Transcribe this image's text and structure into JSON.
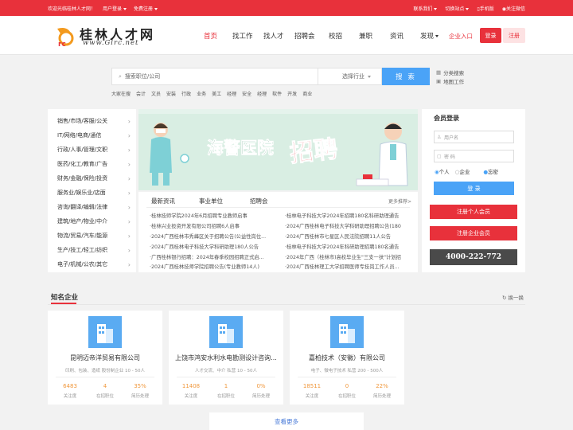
{
  "topbar": {
    "welcome": "欢迎光临桂林人才网！",
    "personal_login": "用户登录",
    "free_register": "免费注册",
    "contact_us": "联系我们",
    "switch_site": "切换站点",
    "mobile": "手机版",
    "wechat": "关注微信"
  },
  "header": {
    "logo_name": "桂林人才网",
    "logo_url": "www.Glrc.net",
    "nav": [
      "首页",
      "找工作",
      "找人才",
      "招聘会",
      "校招",
      "兼职",
      "资讯",
      "发现"
    ],
    "enterprise_entry": "企业入口",
    "login": "登录",
    "register": "注册"
  },
  "search": {
    "placeholder": "搜索职位/公司",
    "industry": "选择行业",
    "button": "搜 索",
    "category_search": "分类搜索",
    "map_search": "地图工作",
    "hotwords": [
      "大家在搜",
      "会计",
      "文员",
      "安装",
      "行政",
      "业务",
      "美工",
      "经理",
      "安全",
      "经理",
      "软件",
      "开发",
      "商业"
    ]
  },
  "categories": [
    "销售/市场/客服/公关",
    "IT/网络/电商/通信",
    "行政/人事/管理/文职",
    "医药/化工/教育/广告",
    "财务/金融/保险/投资",
    "服务业/娱乐业/店面",
    "咨询/翻译/编辑/法律",
    "建筑/地产/物业/中介",
    "物流/贸易/汽车/能源",
    "生产/技工/轻工/纺织",
    "电子/机械/公农/其它"
  ],
  "banner": {
    "text_main": "海警医院",
    "text_accent": "招聘"
  },
  "news": {
    "tabs": [
      "最新资讯",
      "事业单位",
      "招聘会"
    ],
    "more": "更多推荐>",
    "left": [
      "桂林技师学院2024年6月招聘专业教师启事",
      "桂林兴业投资开发有限公司招聘6人启事",
      "2024广西桂林市秀峰区关于招聘公告(公益性岗位...",
      "2024广西桂林电子科技大学科研助理180人公告",
      "广西桂林银行招聘：2024年春季校园招聘正式启...",
      "2024广西桂林技师学院招聘公告(专业教师14人)"
    ],
    "right": [
      "桂林电子科技大学2024年招聘180名科研助理通告",
      "2024广西桂林电子科技大学科研助理招聘公告(180",
      "2024广西桂林市七星区人民法院招聘11人公告",
      "桂林电子科技大学2024年科研助理招聘180名通告",
      "2024年广西（桂林市)高校毕业生\"三支一扶\"计划招",
      "2024广西桂林理工大学招聘医师专技岗工作人员..."
    ]
  },
  "member": {
    "title": "会员登录",
    "username": "用户名",
    "password": "密 码",
    "personal": "个人",
    "enterprise": "企业",
    "forgot": "忘密",
    "login": "登 录",
    "reg_personal": "注册个人会员",
    "reg_enterprise": "注册企业会员",
    "phone": "4000-222-772"
  },
  "companies_section": {
    "title": "知名企业",
    "swap": "换一换",
    "more": "查看更多"
  },
  "companies": [
    {
      "name": "昆明迈帝洋贸易有限公司",
      "info": "印刷、包装、造纸 股份制企业 10 - 50人",
      "stats": [
        {
          "value": "6483",
          "label": "关注度"
        },
        {
          "value": "4",
          "label": "在招职位"
        },
        {
          "value": "35%",
          "label": "简历处理"
        }
      ]
    },
    {
      "name": "上饶市鸿安水利水电勘测设计咨询...",
      "info": "人才交流、中介 私营 10 - 50人",
      "stats": [
        {
          "value": "11408",
          "label": "关注度"
        },
        {
          "value": "1",
          "label": "在招职位"
        },
        {
          "value": "0%",
          "label": "简历处理"
        }
      ]
    },
    {
      "name": "嘉柏技术（安徽）有限公司",
      "info": "电子、微电子技术 私营 200 - 500人",
      "stats": [
        {
          "value": "18511",
          "label": "关注度"
        },
        {
          "value": "0",
          "label": "在招职位"
        },
        {
          "value": "22%",
          "label": "简历处理"
        }
      ]
    }
  ],
  "colors": {
    "brand_red": "#e8313b",
    "accent_blue": "#4aa3f7",
    "stat_orange": "#f0983d"
  }
}
